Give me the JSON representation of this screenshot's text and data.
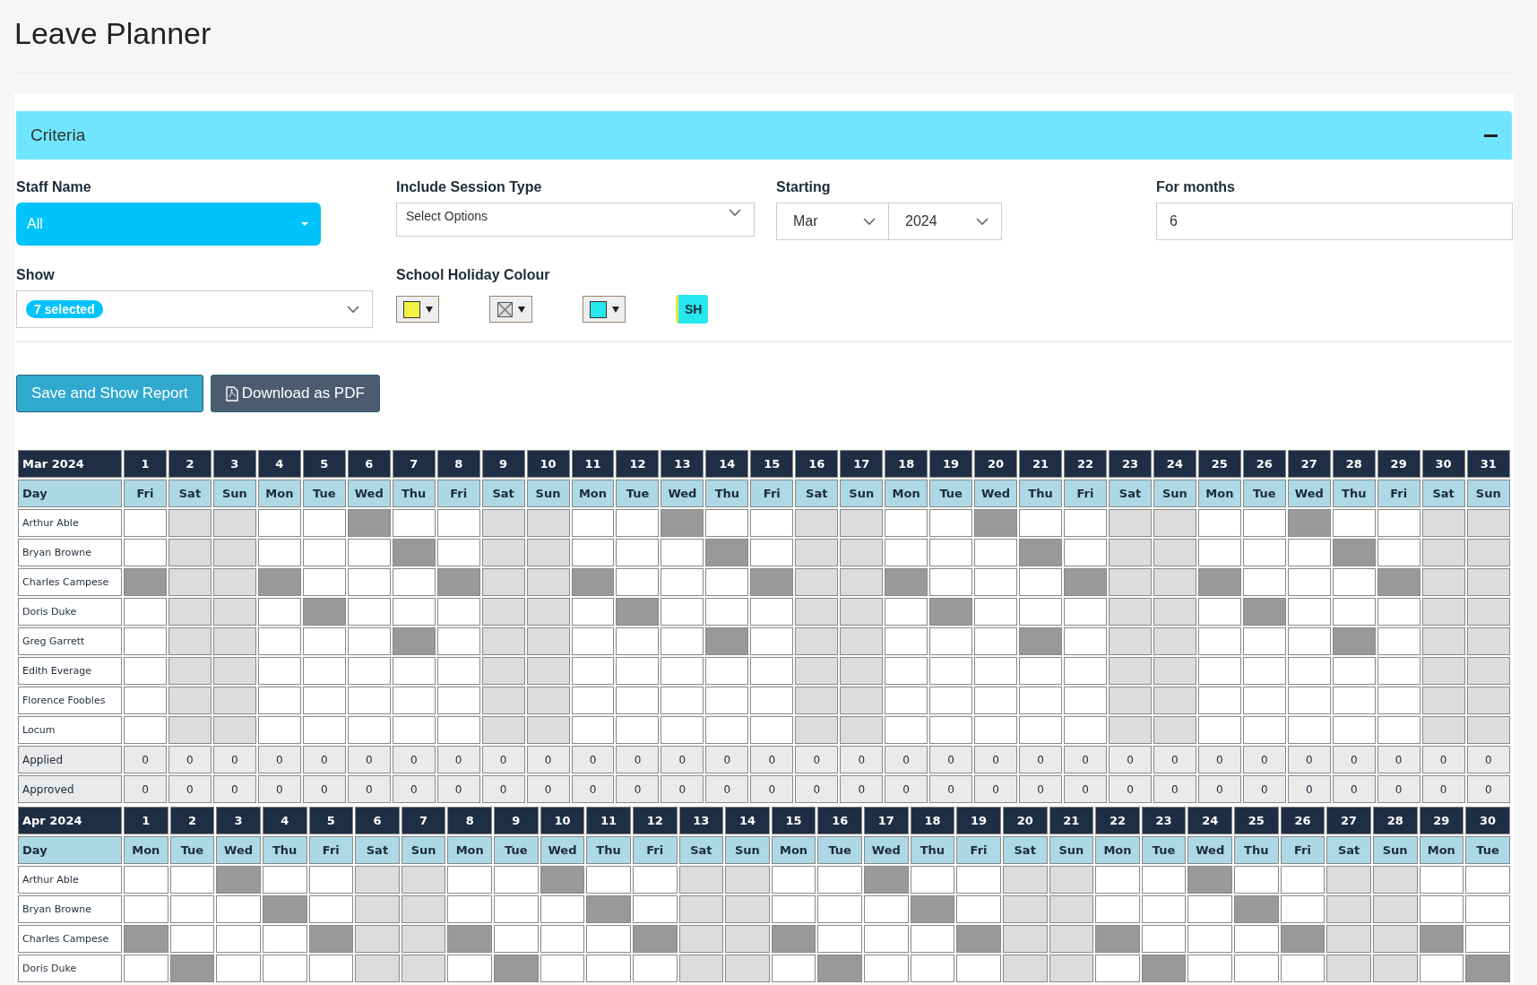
{
  "title": "Leave Planner",
  "criteria": {
    "title": "Criteria",
    "expanded": true,
    "staff_name": {
      "label": "Staff Name",
      "value": "All"
    },
    "session_type": {
      "label": "Include Session Type",
      "placeholder": "Select Options"
    },
    "starting": {
      "label": "Starting",
      "month": "Mar",
      "year": "2024"
    },
    "for_months": {
      "label": "For months",
      "value": "6"
    },
    "show": {
      "label": "Show",
      "tag": "7 selected"
    },
    "school_holiday": {
      "label": "School Holiday Colour",
      "swatches": [
        {
          "kind": "swatch",
          "color": "#f2f244"
        },
        {
          "kind": "none"
        },
        {
          "kind": "swatch",
          "color": "#26e8ee"
        }
      ],
      "badge": "SH"
    }
  },
  "buttons": [
    {
      "kind": "primary",
      "label": "Save and Show Report"
    },
    {
      "kind": "pdf",
      "label": "Download as PDF"
    }
  ],
  "months": [
    {
      "label": "Mar 2024",
      "day_label": "Day",
      "days": [
        {
          "date": "1",
          "day": "Fri"
        },
        {
          "date": "2",
          "day": "Sat"
        },
        {
          "date": "3",
          "day": "Sun"
        },
        {
          "date": "4",
          "day": "Mon"
        },
        {
          "date": "5",
          "day": "Tue"
        },
        {
          "date": "6",
          "day": "Wed"
        },
        {
          "date": "7",
          "day": "Thu"
        },
        {
          "date": "8",
          "day": "Fri"
        },
        {
          "date": "9",
          "day": "Sat"
        },
        {
          "date": "10",
          "day": "Sun"
        },
        {
          "date": "11",
          "day": "Mon"
        },
        {
          "date": "12",
          "day": "Tue"
        },
        {
          "date": "13",
          "day": "Wed"
        },
        {
          "date": "14",
          "day": "Thu"
        },
        {
          "date": "15",
          "day": "Fri"
        },
        {
          "date": "16",
          "day": "Sat"
        },
        {
          "date": "17",
          "day": "Sun"
        },
        {
          "date": "18",
          "day": "Mon"
        },
        {
          "date": "19",
          "day": "Tue"
        },
        {
          "date": "20",
          "day": "Wed"
        },
        {
          "date": "21",
          "day": "Thu"
        },
        {
          "date": "22",
          "day": "Fri"
        },
        {
          "date": "23",
          "day": "Sat"
        },
        {
          "date": "24",
          "day": "Sun"
        },
        {
          "date": "25",
          "day": "Mon"
        },
        {
          "date": "26",
          "day": "Tue"
        },
        {
          "date": "27",
          "day": "Wed"
        },
        {
          "date": "28",
          "day": "Thu"
        },
        {
          "date": "29",
          "day": "Fri"
        },
        {
          "date": "30",
          "day": "Sat"
        },
        {
          "date": "31",
          "day": "Sun"
        }
      ],
      "rows": [
        {
          "name": "Arthur Able",
          "off": [
            false,
            false,
            false,
            false,
            false,
            true,
            false,
            false,
            false,
            false,
            false,
            false,
            true,
            false,
            false,
            false,
            false,
            false,
            false,
            true,
            false,
            false,
            false,
            false,
            false,
            false,
            true,
            false,
            false,
            false,
            false
          ],
          "weekend": [
            false,
            true,
            true,
            false,
            false,
            false,
            false,
            false,
            true,
            true,
            false,
            false,
            false,
            false,
            false,
            true,
            true,
            false,
            false,
            false,
            false,
            false,
            true,
            true,
            false,
            false,
            false,
            false,
            false,
            true,
            true
          ]
        },
        {
          "name": "Bryan Browne",
          "off": [
            false,
            false,
            false,
            false,
            false,
            false,
            true,
            false,
            false,
            false,
            false,
            false,
            false,
            true,
            false,
            false,
            false,
            false,
            false,
            false,
            true,
            false,
            false,
            false,
            false,
            false,
            false,
            true,
            false,
            false,
            false
          ],
          "weekend": [
            false,
            true,
            true,
            false,
            false,
            false,
            false,
            false,
            true,
            true,
            false,
            false,
            false,
            false,
            false,
            true,
            true,
            false,
            false,
            false,
            false,
            false,
            true,
            true,
            false,
            false,
            false,
            false,
            false,
            true,
            true
          ]
        },
        {
          "name": "Charles Campese",
          "off": [
            true,
            false,
            false,
            true,
            false,
            false,
            false,
            true,
            false,
            false,
            true,
            false,
            false,
            false,
            true,
            false,
            false,
            true,
            false,
            false,
            false,
            true,
            false,
            false,
            true,
            false,
            false,
            false,
            true,
            false,
            false
          ],
          "weekend": [
            false,
            true,
            true,
            false,
            false,
            false,
            false,
            false,
            true,
            true,
            false,
            false,
            false,
            false,
            false,
            true,
            true,
            false,
            false,
            false,
            false,
            false,
            true,
            true,
            false,
            false,
            false,
            false,
            false,
            true,
            true
          ]
        },
        {
          "name": "Doris Duke",
          "off": [
            false,
            false,
            false,
            false,
            true,
            false,
            false,
            false,
            false,
            false,
            false,
            true,
            false,
            false,
            false,
            false,
            false,
            false,
            true,
            false,
            false,
            false,
            false,
            false,
            false,
            true,
            false,
            false,
            false,
            false,
            false
          ],
          "weekend": [
            false,
            true,
            true,
            false,
            false,
            false,
            false,
            false,
            true,
            true,
            false,
            false,
            false,
            false,
            false,
            true,
            true,
            false,
            false,
            false,
            false,
            false,
            true,
            true,
            false,
            false,
            false,
            false,
            false,
            true,
            true
          ]
        },
        {
          "name": "Greg Garrett",
          "off": [
            false,
            false,
            false,
            false,
            false,
            false,
            true,
            false,
            false,
            false,
            false,
            false,
            false,
            true,
            false,
            false,
            false,
            false,
            false,
            false,
            true,
            false,
            false,
            false,
            false,
            false,
            false,
            true,
            false,
            false,
            false
          ],
          "weekend": [
            false,
            true,
            true,
            false,
            false,
            false,
            false,
            false,
            true,
            true,
            false,
            false,
            false,
            false,
            false,
            true,
            true,
            false,
            false,
            false,
            false,
            false,
            true,
            true,
            false,
            false,
            false,
            false,
            false,
            true,
            true
          ]
        },
        {
          "name": "Edith Everage",
          "off": [
            false,
            false,
            false,
            false,
            false,
            false,
            false,
            false,
            false,
            false,
            false,
            false,
            false,
            false,
            false,
            false,
            false,
            false,
            false,
            false,
            false,
            false,
            false,
            false,
            false,
            false,
            false,
            false,
            false,
            false,
            false
          ],
          "weekend": [
            false,
            true,
            true,
            false,
            false,
            false,
            false,
            false,
            true,
            true,
            false,
            false,
            false,
            false,
            false,
            true,
            true,
            false,
            false,
            false,
            false,
            false,
            true,
            true,
            false,
            false,
            false,
            false,
            false,
            true,
            true
          ]
        },
        {
          "name": "Florence Foobles",
          "off": [
            false,
            false,
            false,
            false,
            false,
            false,
            false,
            false,
            false,
            false,
            false,
            false,
            false,
            false,
            false,
            false,
            false,
            false,
            false,
            false,
            false,
            false,
            false,
            false,
            false,
            false,
            false,
            false,
            false,
            false,
            false
          ],
          "weekend": [
            false,
            true,
            true,
            false,
            false,
            false,
            false,
            false,
            true,
            true,
            false,
            false,
            false,
            false,
            false,
            true,
            true,
            false,
            false,
            false,
            false,
            false,
            true,
            true,
            false,
            false,
            false,
            false,
            false,
            true,
            true
          ]
        },
        {
          "name": "Locum",
          "off": [
            false,
            false,
            false,
            false,
            false,
            false,
            false,
            false,
            false,
            false,
            false,
            false,
            false,
            false,
            false,
            false,
            false,
            false,
            false,
            false,
            false,
            false,
            false,
            false,
            false,
            false,
            false,
            false,
            false,
            false,
            false
          ],
          "weekend": [
            false,
            true,
            true,
            false,
            false,
            false,
            false,
            false,
            true,
            true,
            false,
            false,
            false,
            false,
            false,
            true,
            true,
            false,
            false,
            false,
            false,
            false,
            true,
            true,
            false,
            false,
            false,
            false,
            false,
            true,
            true
          ]
        }
      ],
      "totals": [
        {
          "label": "Applied",
          "values": [
            "0",
            "0",
            "0",
            "0",
            "0",
            "0",
            "0",
            "0",
            "0",
            "0",
            "0",
            "0",
            "0",
            "0",
            "0",
            "0",
            "0",
            "0",
            "0",
            "0",
            "0",
            "0",
            "0",
            "0",
            "0",
            "0",
            "0",
            "0",
            "0",
            "0",
            "0"
          ]
        },
        {
          "label": "Approved",
          "values": [
            "0",
            "0",
            "0",
            "0",
            "0",
            "0",
            "0",
            "0",
            "0",
            "0",
            "0",
            "0",
            "0",
            "0",
            "0",
            "0",
            "0",
            "0",
            "0",
            "0",
            "0",
            "0",
            "0",
            "0",
            "0",
            "0",
            "0",
            "0",
            "0",
            "0",
            "0"
          ]
        }
      ]
    },
    {
      "label": "Apr 2024",
      "day_label": "Day",
      "days": [
        {
          "date": "1",
          "day": "Mon"
        },
        {
          "date": "2",
          "day": "Tue"
        },
        {
          "date": "3",
          "day": "Wed"
        },
        {
          "date": "4",
          "day": "Thu"
        },
        {
          "date": "5",
          "day": "Fri"
        },
        {
          "date": "6",
          "day": "Sat"
        },
        {
          "date": "7",
          "day": "Sun"
        },
        {
          "date": "8",
          "day": "Mon"
        },
        {
          "date": "9",
          "day": "Tue"
        },
        {
          "date": "10",
          "day": "Wed"
        },
        {
          "date": "11",
          "day": "Thu"
        },
        {
          "date": "12",
          "day": "Fri"
        },
        {
          "date": "13",
          "day": "Sat"
        },
        {
          "date": "14",
          "day": "Sun"
        },
        {
          "date": "15",
          "day": "Mon"
        },
        {
          "date": "16",
          "day": "Tue"
        },
        {
          "date": "17",
          "day": "Wed"
        },
        {
          "date": "18",
          "day": "Thu"
        },
        {
          "date": "19",
          "day": "Fri"
        },
        {
          "date": "20",
          "day": "Sat"
        },
        {
          "date": "21",
          "day": "Sun"
        },
        {
          "date": "22",
          "day": "Mon"
        },
        {
          "date": "23",
          "day": "Tue"
        },
        {
          "date": "24",
          "day": "Wed"
        },
        {
          "date": "25",
          "day": "Thu"
        },
        {
          "date": "26",
          "day": "Fri"
        },
        {
          "date": "27",
          "day": "Sat"
        },
        {
          "date": "28",
          "day": "Sun"
        },
        {
          "date": "29",
          "day": "Mon"
        },
        {
          "date": "30",
          "day": "Tue"
        }
      ],
      "rows": [
        {
          "name": "Arthur Able",
          "off": [
            false,
            false,
            true,
            false,
            false,
            false,
            false,
            false,
            false,
            true,
            false,
            false,
            false,
            false,
            false,
            false,
            true,
            false,
            false,
            false,
            false,
            false,
            false,
            true,
            false,
            false,
            false,
            false,
            false,
            false
          ],
          "weekend": [
            false,
            false,
            false,
            false,
            false,
            true,
            true,
            false,
            false,
            false,
            false,
            false,
            true,
            true,
            false,
            false,
            false,
            false,
            false,
            true,
            true,
            false,
            false,
            false,
            false,
            false,
            true,
            true,
            false,
            false
          ]
        },
        {
          "name": "Bryan Browne",
          "off": [
            false,
            false,
            false,
            true,
            false,
            false,
            false,
            false,
            false,
            false,
            true,
            false,
            false,
            false,
            false,
            false,
            false,
            true,
            false,
            false,
            false,
            false,
            false,
            false,
            true,
            false,
            false,
            false,
            false,
            false
          ],
          "weekend": [
            false,
            false,
            false,
            false,
            false,
            true,
            true,
            false,
            false,
            false,
            false,
            false,
            true,
            true,
            false,
            false,
            false,
            false,
            false,
            true,
            true,
            false,
            false,
            false,
            false,
            false,
            true,
            true,
            false,
            false
          ]
        },
        {
          "name": "Charles Campese",
          "off": [
            true,
            false,
            false,
            false,
            true,
            false,
            false,
            true,
            false,
            false,
            false,
            true,
            false,
            false,
            true,
            false,
            false,
            false,
            true,
            false,
            false,
            true,
            false,
            false,
            false,
            true,
            false,
            false,
            true,
            false
          ],
          "weekend": [
            false,
            false,
            false,
            false,
            false,
            true,
            true,
            false,
            false,
            false,
            false,
            false,
            true,
            true,
            false,
            false,
            false,
            false,
            false,
            true,
            true,
            false,
            false,
            false,
            false,
            false,
            true,
            true,
            false,
            false
          ]
        },
        {
          "name": "Doris Duke",
          "off": [
            false,
            true,
            false,
            false,
            false,
            false,
            false,
            false,
            true,
            false,
            false,
            false,
            false,
            false,
            false,
            true,
            false,
            false,
            false,
            false,
            false,
            false,
            true,
            false,
            false,
            false,
            false,
            false,
            false,
            true
          ],
          "weekend": [
            false,
            false,
            false,
            false,
            false,
            true,
            true,
            false,
            false,
            false,
            false,
            false,
            true,
            true,
            false,
            false,
            false,
            false,
            false,
            true,
            true,
            false,
            false,
            false,
            false,
            false,
            true,
            true,
            false,
            false
          ]
        }
      ]
    }
  ]
}
